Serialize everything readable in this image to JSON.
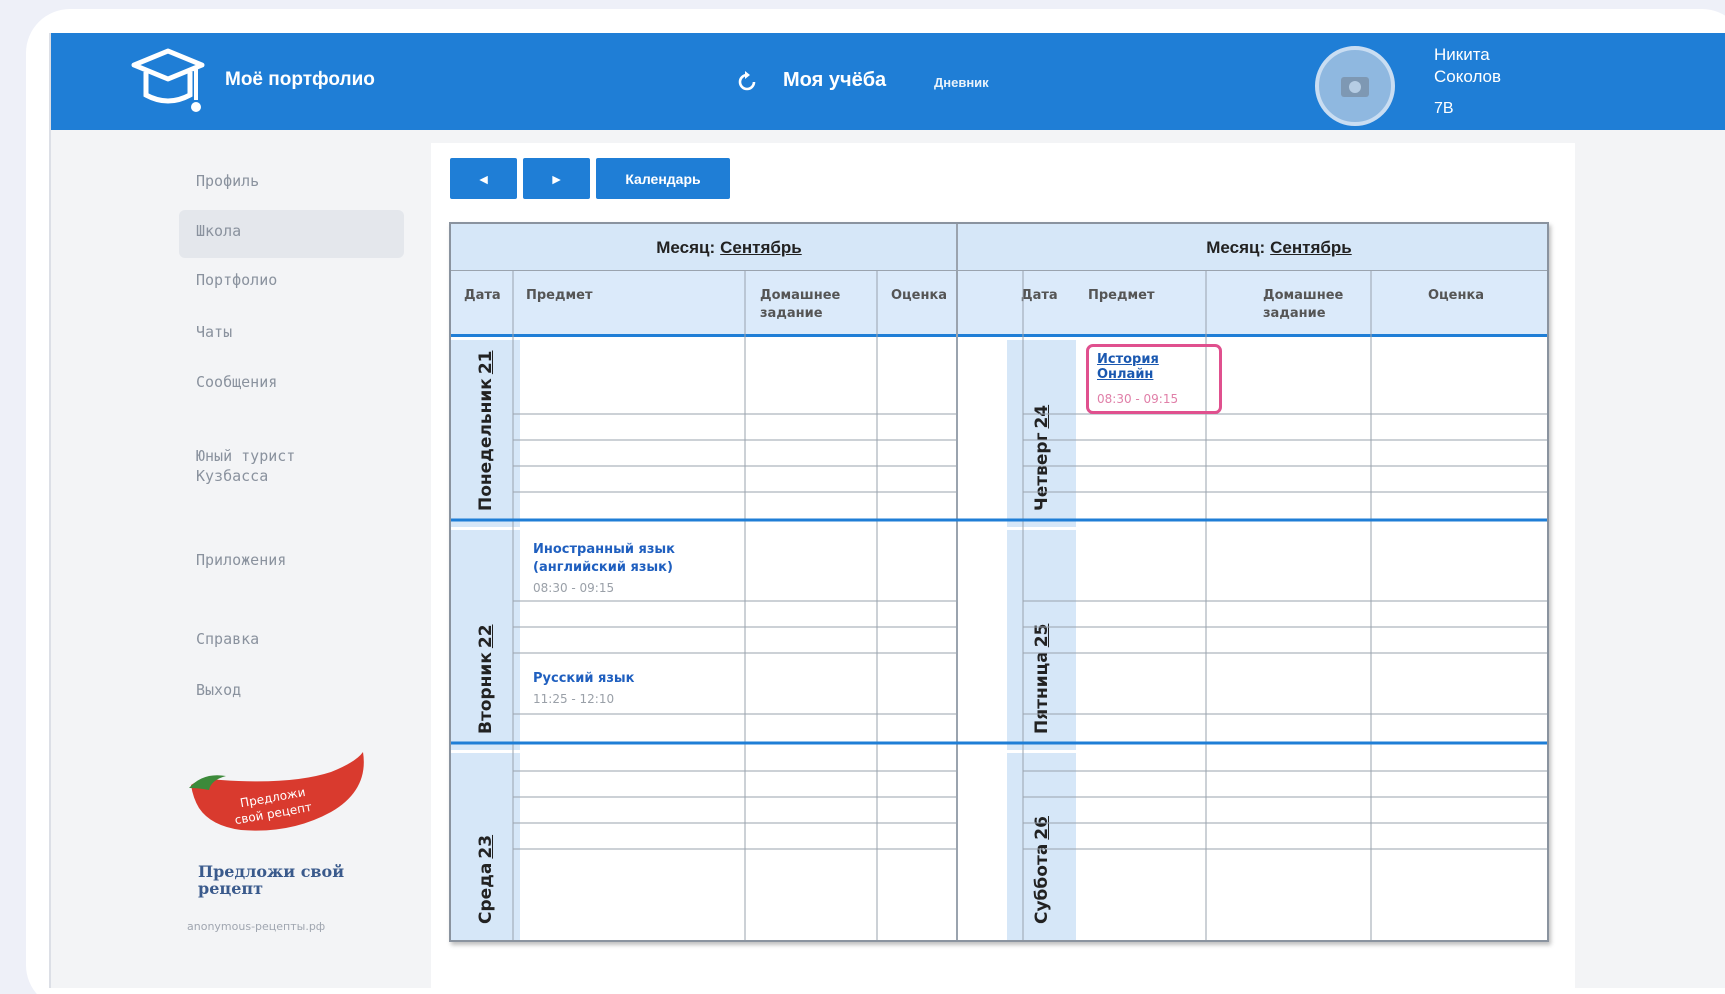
{
  "header": {
    "app_title": "Моё портфолио",
    "nav_title": "Моя учёба",
    "nav_sub": "Дневник",
    "user_first": "Никита",
    "user_last": "Соколов",
    "user_class": "7В"
  },
  "sidebar": {
    "items": [
      "Профиль",
      "Школа",
      "Портфолио",
      "Чаты",
      "Сообщения",
      "Юный турист Кузбасса",
      "Приложения",
      "Справка",
      "Выход"
    ],
    "active_index": 1,
    "promo_badge_line1": "Предложи",
    "promo_badge_line2": "свой рецепт",
    "promo_title": "Предложи свой рецепт",
    "promo_url": "anonymous-рецепты.рф"
  },
  "toolbar": {
    "prev_label": "◄",
    "next_label": "►",
    "calendar_label": "Календарь"
  },
  "table": {
    "month_prefix": "Месяц:",
    "month_left": "Сентябрь",
    "month_right": "Сентябрь",
    "columns": [
      "Дата",
      "Предмет",
      "Домашнее задание",
      "Оценка"
    ],
    "days_left": [
      {
        "name": "Понедельник",
        "date": "21"
      },
      {
        "name": "Вторник",
        "date": "22"
      },
      {
        "name": "Среда",
        "date": "23"
      }
    ],
    "days_right": [
      {
        "name": "Четверг",
        "date": "24"
      },
      {
        "name": "Пятница",
        "date": "25"
      },
      {
        "name": "Суббота",
        "date": "26"
      }
    ],
    "lessons": {
      "tue_1_name": "Иностранный язык (английский язык)",
      "tue_1_time": "08:30 - 09:15",
      "tue_2_name": "Русский язык",
      "tue_2_time": "11:25 - 12:10",
      "thu_1_name": "История Онлайн",
      "thu_1_time": "08:30 - 09:15"
    }
  },
  "colors": {
    "brand": "#1f7ed6",
    "highlight": "#e0508e"
  }
}
